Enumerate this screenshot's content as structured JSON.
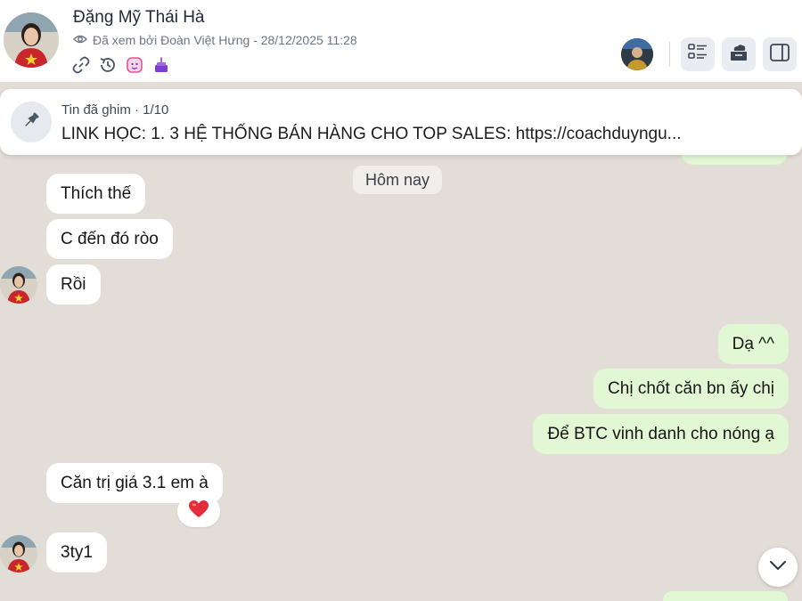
{
  "header": {
    "title": "Đặng Mỹ Thái Hà",
    "seen_text": "Đã xem bởi Đoàn Việt Hưng - 28/12/2025 11:28",
    "quick_icons": [
      "link-icon",
      "history-icon",
      "avatar-icon",
      "cake-icon"
    ],
    "right_buttons": [
      "list-icon",
      "cloud-tray-icon",
      "sidebar-panel-icon"
    ]
  },
  "pinned": {
    "title": "Tin đã ghim · 1/10",
    "text": "LINK HỌC: 1. 3 HỆ THỐNG BÁN HÀNG CHO TOP SALES: https://coachduyngu..."
  },
  "date_separator": "Hôm nay",
  "messages": [
    {
      "direction": "in",
      "text": "Thích thế"
    },
    {
      "direction": "in",
      "text": "C đến đó ròo"
    },
    {
      "direction": "in",
      "text": "Rồi"
    },
    {
      "direction": "out",
      "text": "Dạ ^^"
    },
    {
      "direction": "out",
      "text": "Chị chốt căn bn ấy chị"
    },
    {
      "direction": "out",
      "text": "Để BTC vinh danh cho nóng ạ"
    },
    {
      "direction": "in",
      "text": "Căn trị giá 3.1 em à",
      "reaction": "heart"
    },
    {
      "direction": "in",
      "text": "3ty1"
    }
  ],
  "colors": {
    "background": "#e2ddd6",
    "incoming_bubble": "#ffffff",
    "outgoing_bubble": "#e2f7d4",
    "reaction_heart": "#e02e3c",
    "accent_purple": "#7c3fd1",
    "accent_pink": "#e0569b"
  }
}
